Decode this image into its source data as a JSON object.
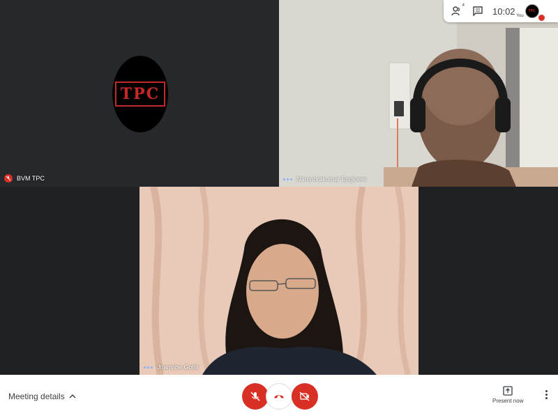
{
  "tiles": {
    "tpc": {
      "name": "BVM TPC",
      "logo_text": "TPC",
      "muted": true
    },
    "narendra": {
      "name": "Narendrakumar Engineer",
      "speaking_indicator": true
    },
    "jhanvi": {
      "name": "Jhanvibe Gohil",
      "speaking_indicator": true
    }
  },
  "topbar": {
    "participants_count": "4",
    "time": "10:02",
    "self_label": "You",
    "self_avatar_text": "TPC"
  },
  "bottombar": {
    "meeting_details_label": "Meeting details",
    "present_label": "Present now"
  },
  "icons": {
    "participants": "people-icon",
    "chat": "chat-icon",
    "mic_off": "mic-off-icon",
    "hangup": "call-end-icon",
    "cam_off": "videocam-off-icon",
    "present": "present-icon",
    "more": "more-vert-icon"
  },
  "colors": {
    "accent_red": "#d93025",
    "speaking_blue": "#8ab4f8",
    "logo_red": "#c62828"
  }
}
